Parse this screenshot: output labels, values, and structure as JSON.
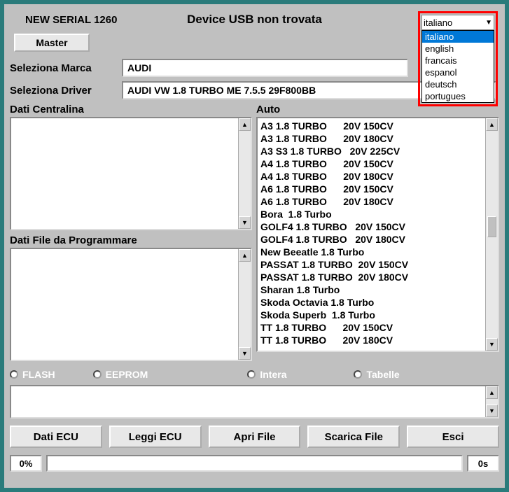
{
  "header": {
    "serial": "NEW SERIAL 1260",
    "usb_status": "Device USB non trovata",
    "master_btn": "Master"
  },
  "language": {
    "selected": "italiano",
    "options": [
      "italiano",
      "english",
      "francais",
      "espanol",
      "deutsch",
      "portugues"
    ]
  },
  "fields": {
    "marca_label": "Seleziona Marca",
    "marca_value": "AUDI",
    "driver_label": "Seleziona Driver",
    "driver_value": "AUDI VW 1.8 TURBO ME 7.5.5 29F800BB"
  },
  "panels": {
    "dati_centralina_label": "Dati Centralina",
    "dati_file_label": "Dati File da Programmare",
    "auto_label": "Auto",
    "auto_items": [
      "A3 1.8 TURBO      20V 150CV",
      "A3 1.8 TURBO      20V 180CV",
      "A3 S3 1.8 TURBO   20V 225CV",
      "A4 1.8 TURBO      20V 150CV",
      "A4 1.8 TURBO      20V 180CV",
      "A6 1.8 TURBO      20V 150CV",
      "A6 1.8 TURBO      20V 180CV",
      "Bora  1.8 Turbo",
      "GOLF4 1.8 TURBO   20V 150CV",
      "GOLF4 1.8 TURBO   20V 180CV",
      "New Beeatle 1.8 Turbo",
      "PASSAT 1.8 TURBO  20V 150CV",
      "PASSAT 1.8 TURBO  20V 180CV",
      "Sharan 1.8 Turbo",
      "Skoda Octavia 1.8 Turbo",
      "Skoda Superb  1.8 Turbo",
      "TT 1.8 TURBO      20V 150CV",
      "TT 1.8 TURBO      20V 180CV"
    ]
  },
  "radios": {
    "flash": "FLASH",
    "eeprom": "EEPROM",
    "intera": "Intera",
    "tabelle": "Tabelle"
  },
  "buttons": {
    "dati_ecu": "Dati ECU",
    "leggi_ecu": "Leggi ECU",
    "apri_file": "Apri File",
    "scarica_file": "Scarica File",
    "esci": "Esci"
  },
  "progress": {
    "percent": "0%",
    "time": "0s"
  }
}
